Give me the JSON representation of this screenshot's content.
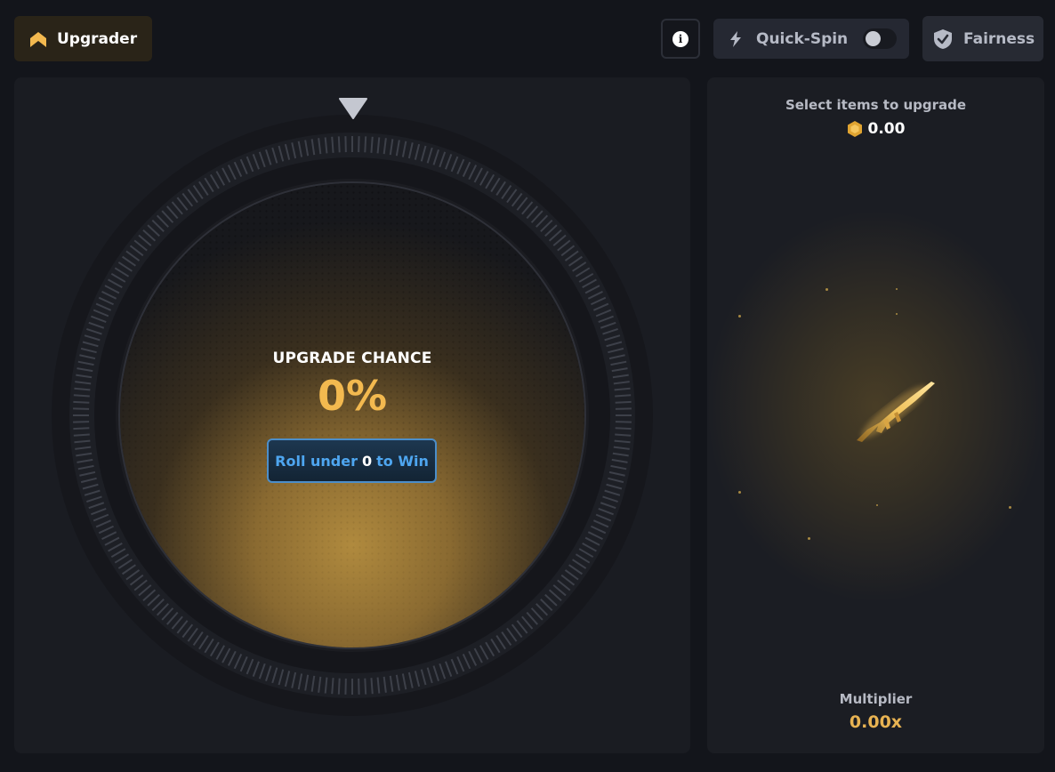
{
  "header": {
    "tab_label": "Upgrader",
    "info_icon": "info-icon",
    "quick_spin_label": "Quick-Spin",
    "quick_spin_enabled": false,
    "fairness_label": "Fairness"
  },
  "wheel": {
    "chance_label": "UPGRADE CHANCE",
    "chance_value": "0%",
    "roll_prefix": "Roll under",
    "roll_number": "0",
    "roll_suffix": "to Win"
  },
  "side": {
    "select_title": "Select items to upgrade",
    "balance": "0.00",
    "multiplier_label": "Multiplier",
    "multiplier_value": "0.00x"
  },
  "colors": {
    "accent_gold": "#f3b94f",
    "roll_blue": "#4ea6f0",
    "panel_bg": "#1a1c22"
  }
}
